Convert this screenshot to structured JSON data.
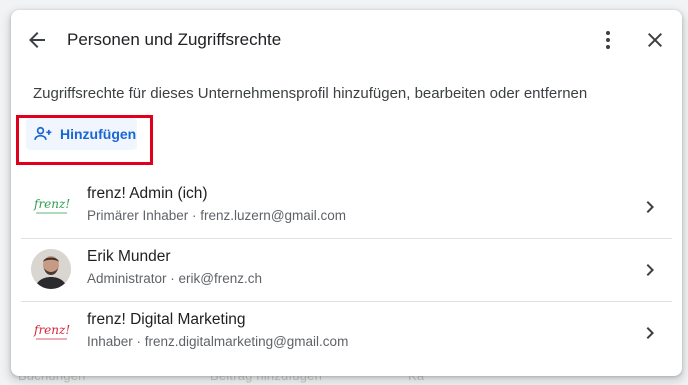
{
  "background": {
    "items": [
      "Buchungen",
      "Beitrag hinzufügen",
      "Kä"
    ]
  },
  "dialog": {
    "title": "Personen und Zugriffsrechte",
    "subtitle": "Zugriffsrechte für dieses Unternehmensprofil hinzufügen, bearbeiten oder entfernen",
    "add_label": "Hinzufügen",
    "icons": {
      "back": "arrow-back-icon",
      "more": "more-vert-icon",
      "close": "close-icon",
      "add": "person-add-icon",
      "chevron": "chevron-right-icon"
    },
    "highlight_color": "#e0001b",
    "people": [
      {
        "name": "frenz! Admin (ich)",
        "role": "Primärer Inhaber",
        "email": "frenz.luzern@gmail.com",
        "detail": "Primärer Inhaber · frenz.luzern@gmail.com",
        "avatar": "frenz-logo-green",
        "logo_text": "frenz!"
      },
      {
        "name": "Erik Munder",
        "role": "Administrator",
        "email": "erik@frenz.ch",
        "detail": "Administrator · erik@frenz.ch",
        "avatar": "person-photo"
      },
      {
        "name": "frenz! Digital Marketing",
        "role": "Inhaber",
        "email": "frenz.digitalmarketing@gmail.com",
        "detail": "Inhaber · frenz.digitalmarketing@gmail.com",
        "avatar": "frenz-logo-red",
        "logo_text": "frenz!"
      }
    ]
  }
}
